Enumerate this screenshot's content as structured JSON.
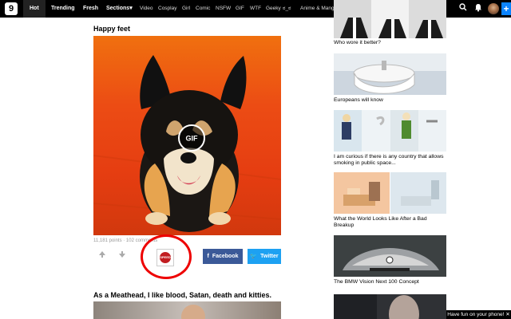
{
  "topbar": {
    "logo": "9",
    "main_nav": [
      "Hot",
      "Trending",
      "Fresh",
      "Sections"
    ],
    "sections_arrow": "▾",
    "categories": [
      "Video",
      "Cosplay",
      "Girl",
      "Comic",
      "NSFW",
      "GIF",
      "WTF",
      "Geeky",
      "ಠ_ಠ",
      "Anime & Manga"
    ],
    "upload_label": "+",
    "colors": {
      "bar": "#000000",
      "upload": "#0b84ff"
    }
  },
  "posts": [
    {
      "title": "Happy feet",
      "media_badge": "GIF",
      "meta": "11,181 points · 102 comments",
      "vote_up_icon": "arrow-up-icon",
      "vote_down_icon": "arrow-down-icon",
      "comment_badge": "SPEED BUMP",
      "share": {
        "facebook": "Facebook",
        "twitter": "Twitter"
      }
    },
    {
      "title": "As a Meathead, I like blood, Satan, death and kitties."
    }
  ],
  "sidebar": {
    "items": [
      {
        "caption": "Who wore it better?"
      },
      {
        "caption": "Europeans will know"
      },
      {
        "caption": "I am curious if there is any country that allows smoking in public space..."
      },
      {
        "caption": "What the World Looks Like After a Bad Breakup"
      },
      {
        "caption": "The BMW Vision Next 100 Concept"
      }
    ]
  },
  "toast": {
    "text": "Have fun on your phone! ✕"
  }
}
